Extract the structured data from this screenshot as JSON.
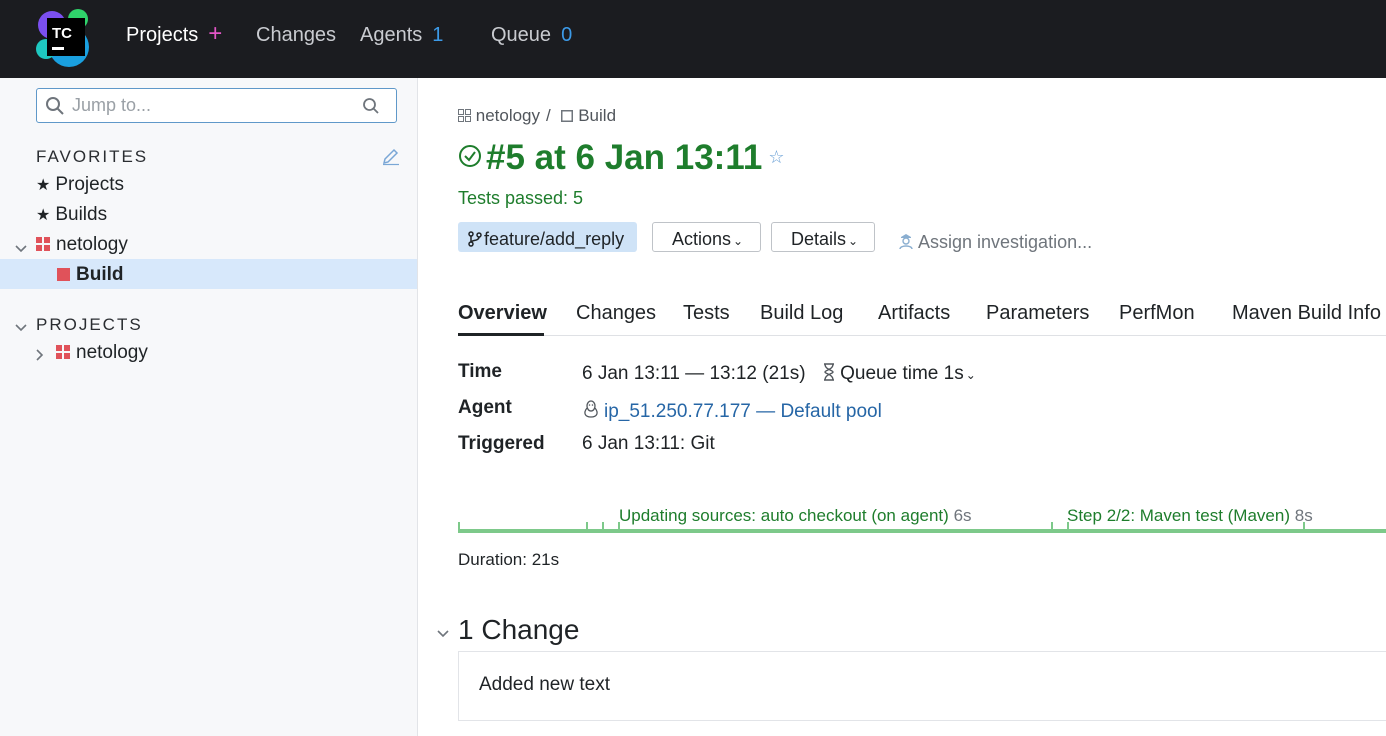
{
  "topbar": {
    "logo_text": "TC",
    "projects_label": "Projects",
    "projects_plus": "+",
    "changes_label": "Changes",
    "agents_label": "Agents",
    "agents_count": "1",
    "queue_label": "Queue",
    "queue_count": "0"
  },
  "sidebar": {
    "search_placeholder": "Jump to...",
    "favorites_title": "FAVORITES",
    "favorites": [
      {
        "star": "★",
        "label": "Projects"
      },
      {
        "star": "★",
        "label": "Builds"
      }
    ],
    "fav_project": "netology",
    "fav_build": "Build",
    "projects_title": "PROJECTS",
    "project": "netology"
  },
  "main": {
    "breadcrumb": {
      "project": "netology",
      "sep": "/",
      "build": "Build"
    },
    "title": "#5 at 6 Jan 13:11",
    "tests_passed": "Tests passed: 5",
    "branch": "feature/add_reply",
    "actions_label": "Actions",
    "details_label": "Details",
    "assign_label": "Assign investigation...",
    "tabs": [
      "Overview",
      "Changes",
      "Tests",
      "Build Log",
      "Artifacts",
      "Parameters",
      "PerfMon",
      "Maven Build Info"
    ],
    "info": {
      "time_label": "Time",
      "time_value": "6 Jan 13:11 — 13:12 (21s)",
      "queue_time": "Queue time 1s",
      "agent_label": "Agent",
      "agent_name": "ip_51.250.77.177",
      "agent_sep": "—",
      "agent_pool": "Default pool",
      "triggered_label": "Triggered",
      "triggered_value": "6 Jan 13:11: Git"
    },
    "timeline": {
      "stage1": "Updating sources: auto checkout (on agent)",
      "stage1_dur": "6s",
      "stage2": "Step 2/2: Maven test (Maven)",
      "stage2_dur": "8s"
    },
    "duration": "Duration: 21s",
    "changes_heading": "1 Change",
    "change_message": "Added new text"
  },
  "colors": {
    "success": "#1e7d2c",
    "accent": "#3c9ae8",
    "topbar": "#1b1c20",
    "selection": "#d7e8fb"
  }
}
